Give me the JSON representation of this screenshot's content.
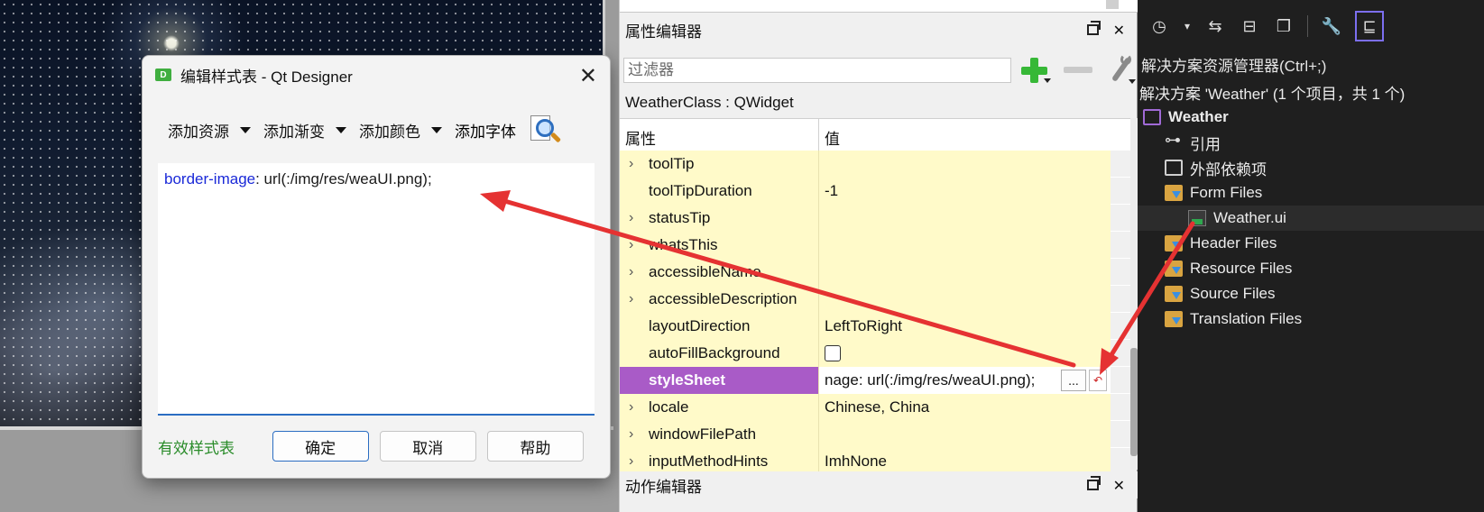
{
  "dialog": {
    "title": "编辑样式表 - Qt Designer",
    "app_icon": "D",
    "close": "✕",
    "toolbar": {
      "add_resource": "添加资源",
      "add_gradient": "添加渐变",
      "add_color": "添加颜色",
      "add_font": "添加字体"
    },
    "editor": {
      "property": "border-image",
      "rest": ": url(:/img/res/weaUI.png);"
    },
    "status": "有效样式表",
    "buttons": {
      "ok": "确定",
      "cancel": "取消",
      "help": "帮助"
    }
  },
  "property_editor": {
    "title": "属性编辑器",
    "filter_placeholder": "过滤器",
    "class_label": "WeatherClass : QWidget",
    "header": {
      "property": "属性",
      "value": "值"
    },
    "rows": [
      {
        "name": "toolTip",
        "value": "",
        "expandable": true
      },
      {
        "name": "toolTipDuration",
        "value": "-1",
        "expandable": false
      },
      {
        "name": "statusTip",
        "value": "",
        "expandable": true
      },
      {
        "name": "whatsThis",
        "value": "",
        "expandable": true
      },
      {
        "name": "accessibleName",
        "value": "",
        "expandable": true
      },
      {
        "name": "accessibleDescription",
        "value": "",
        "expandable": true
      },
      {
        "name": "layoutDirection",
        "value": "LeftToRight",
        "expandable": false
      },
      {
        "name": "autoFillBackground",
        "value": "",
        "expandable": false
      },
      {
        "name": "styleSheet",
        "value": "nage: url(:/img/res/weaUI.png);",
        "expandable": false
      },
      {
        "name": "locale",
        "value": "Chinese, China",
        "expandable": true
      },
      {
        "name": "windowFilePath",
        "value": "",
        "expandable": true
      },
      {
        "name": "inputMethodHints",
        "value": "ImhNone",
        "expandable": true
      }
    ],
    "dots_button": "...",
    "action_editor_title": "动作编辑器"
  },
  "solution_explorer": {
    "search_label": "解决方案资源管理器(Ctrl+;)",
    "solution_label": "解决方案 'Weather' (1 个项目，共 1 个)",
    "project": "Weather",
    "items": {
      "references": "引用",
      "external_deps": "外部依赖项",
      "form_files": "Form Files",
      "weather_ui": "Weather.ui",
      "header_files": "Header Files",
      "resource_files": "Resource Files",
      "source_files": "Source Files",
      "translation_files": "Translation Files"
    }
  },
  "colors": {
    "selected_row": "#a95bc7",
    "property_row": "#fffac9",
    "arrow": "#e53232",
    "valid_text": "#2a8c2a",
    "css_property": "#1a29d8"
  }
}
